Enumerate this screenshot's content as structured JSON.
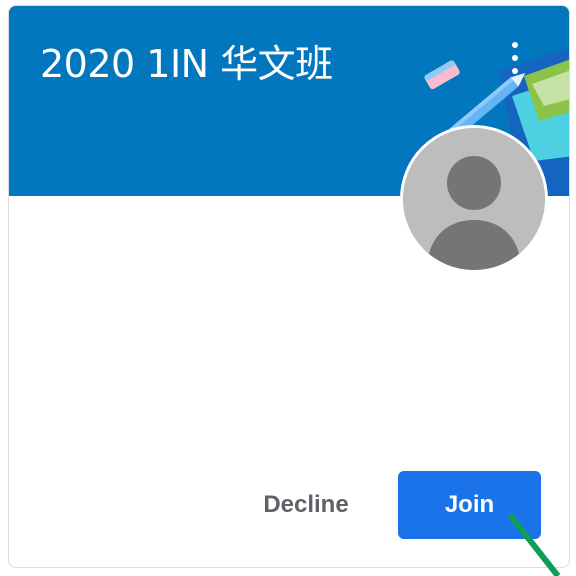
{
  "class_card": {
    "title": "2020 1IN 华文班",
    "decline_label": "Decline",
    "join_label": "Join"
  },
  "icons": {
    "more": "more-vert-icon",
    "avatar": "person-avatar-icon",
    "banner_art": "school-supplies-illustration"
  },
  "colors": {
    "banner": "#0277bd",
    "join_button": "#1a73e8",
    "decline_text": "#5f6368",
    "annotation_arrow": "#0f9d58"
  }
}
